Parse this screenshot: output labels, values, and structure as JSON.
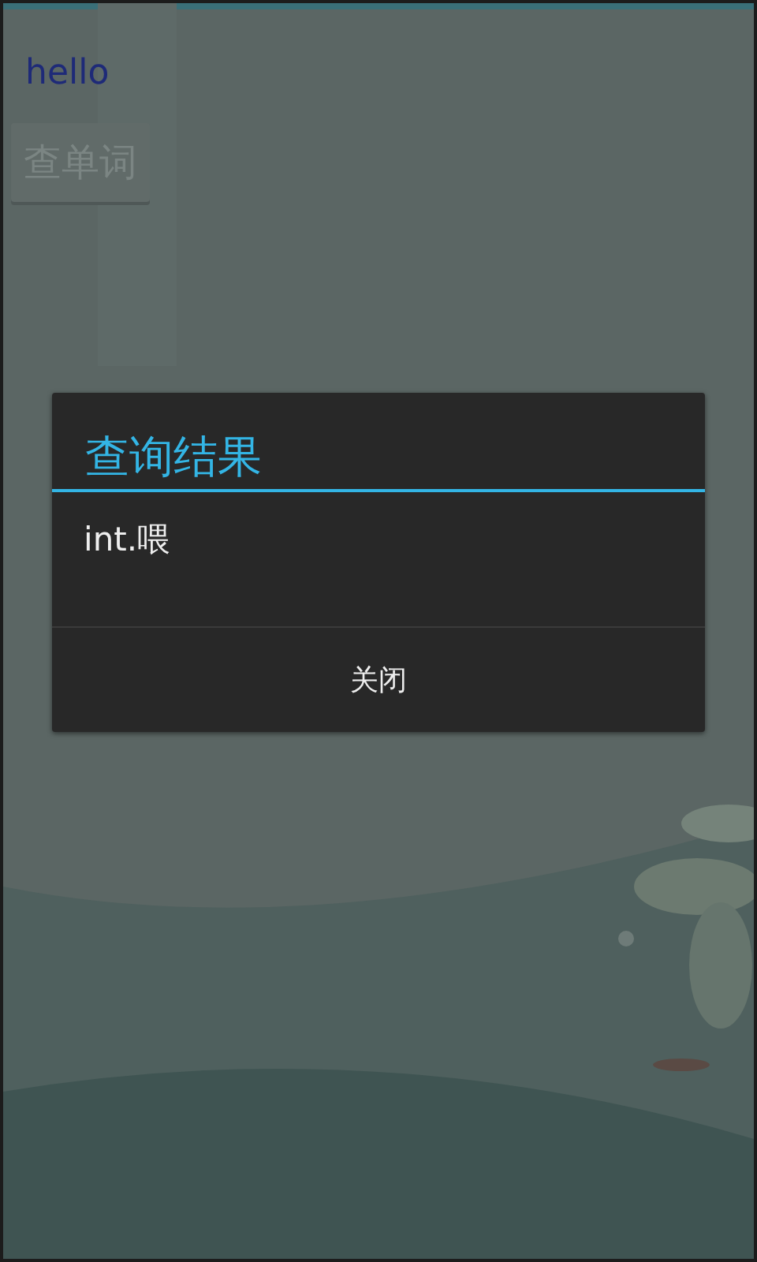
{
  "app": {
    "greeting": "hello",
    "lookup_button": "查单词"
  },
  "dialog": {
    "title": "查询结果",
    "message": "int.喂",
    "buttons": [
      "关闭"
    ]
  }
}
